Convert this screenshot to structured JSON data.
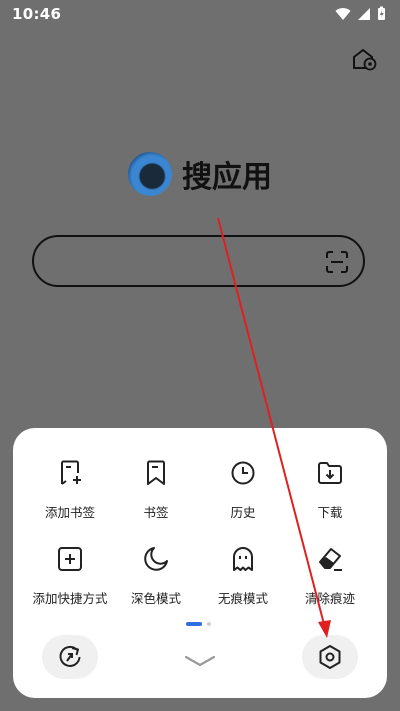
{
  "status_bar": {
    "time": "10:46"
  },
  "app": {
    "name": "搜应用"
  },
  "menu": {
    "items": [
      {
        "label": "添加书签",
        "icon": "add-bookmark-icon"
      },
      {
        "label": "书签",
        "icon": "bookmark-icon"
      },
      {
        "label": "历史",
        "icon": "history-icon"
      },
      {
        "label": "下载",
        "icon": "download-icon"
      },
      {
        "label": "添加快捷方式",
        "icon": "add-shortcut-icon"
      },
      {
        "label": "深色模式",
        "icon": "dark-mode-icon"
      },
      {
        "label": "无痕模式",
        "icon": "incognito-icon"
      },
      {
        "label": "清除痕迹",
        "icon": "clear-traces-icon"
      }
    ],
    "page_indicator": {
      "current": 1,
      "total": 2
    }
  },
  "colors": {
    "accent": "#2f6fe0",
    "annotation_arrow": "#e02020",
    "backdrop": "#6f6f6f"
  }
}
